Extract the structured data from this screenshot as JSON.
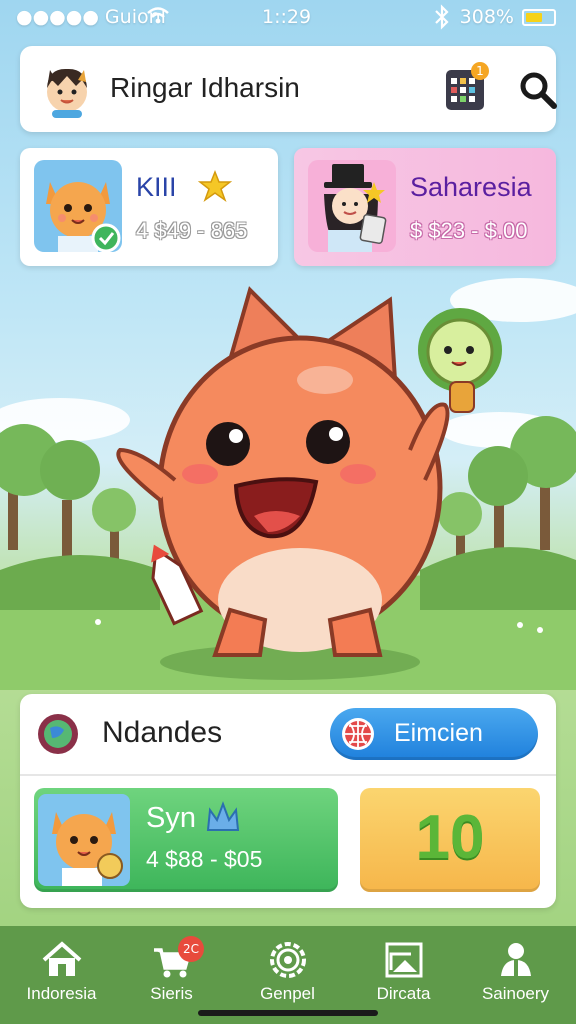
{
  "status_bar": {
    "carrier": "●●●●● Guionl",
    "time": "1::29",
    "battery_text": "308%",
    "battery_level": 0.6
  },
  "header": {
    "title": "Ringar Idharsin",
    "calendar_badge": "1"
  },
  "players": [
    {
      "name": "KIII",
      "range": "4 $49 - 865"
    },
    {
      "name": "Saharesia",
      "range": "$ $23 - $.00"
    }
  ],
  "panel": {
    "title": "Ndandes",
    "button_label": "Eimcien",
    "card": {
      "name": "Syn",
      "range": "4 $88 - $05"
    },
    "score": "10"
  },
  "nav": {
    "items": [
      {
        "label": "Indoresia",
        "icon": "home-icon"
      },
      {
        "label": "Sieris",
        "icon": "cart-icon",
        "badge": "2C"
      },
      {
        "label": "Genpel",
        "icon": "gear-icon"
      },
      {
        "label": "Dircata",
        "icon": "photo-icon"
      },
      {
        "label": "Sainoery",
        "icon": "people-icon"
      }
    ]
  },
  "colors": {
    "accent_blue": "#1f80dc",
    "green_card": "#3db55a",
    "score_card": "#f6b64a",
    "nav_bar": "#5f9a4a"
  }
}
